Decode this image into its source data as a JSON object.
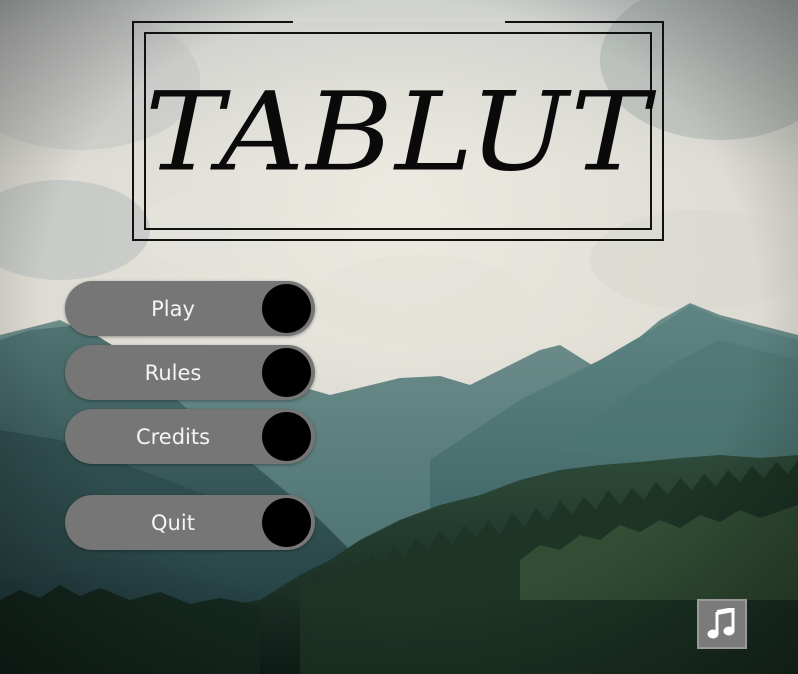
{
  "game": {
    "title": "TABLUT"
  },
  "menu": {
    "play_label": "Play",
    "rules_label": "Rules",
    "credits_label": "Credits",
    "quit_label": "Quit"
  },
  "controls": {
    "music_icon": "music-note-icon"
  },
  "colors": {
    "button_fill": "#767676",
    "button_knob": "#000000",
    "button_text": "#f4f4f4",
    "title_ink": "#0a0a0a"
  }
}
